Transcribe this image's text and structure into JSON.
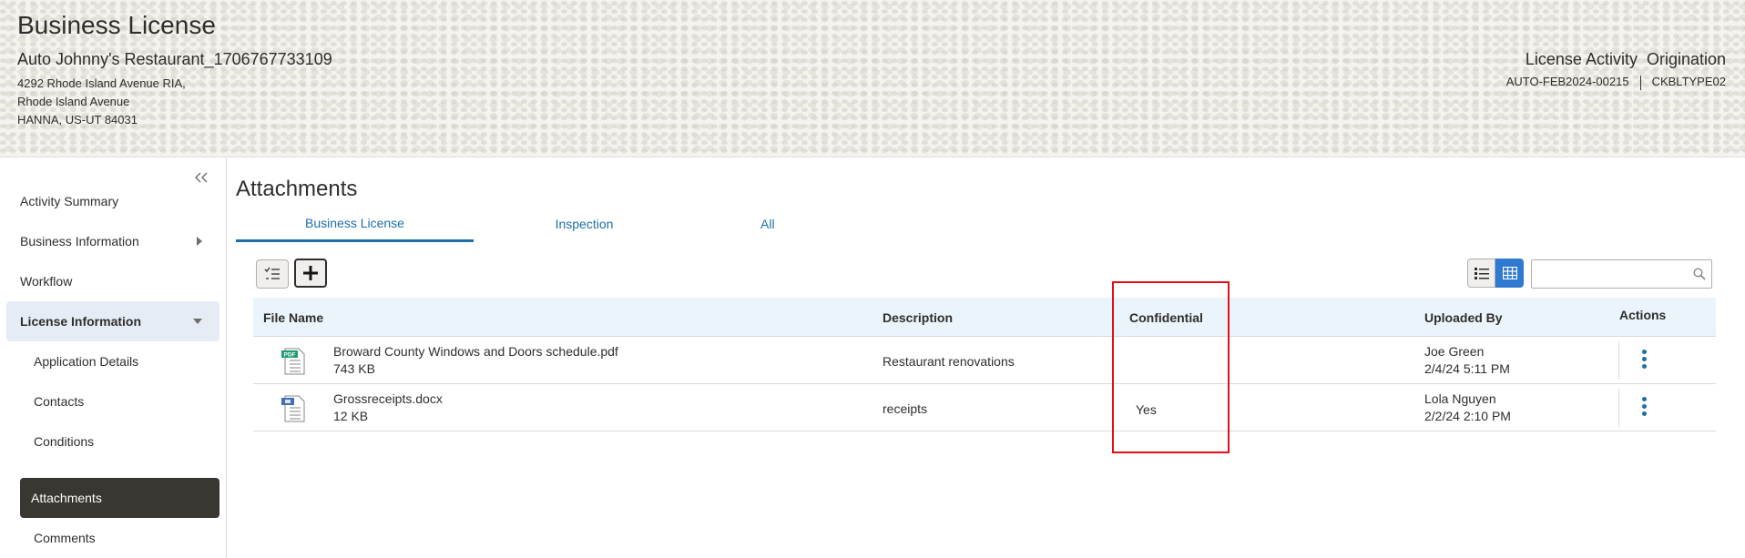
{
  "header": {
    "title": "Business License",
    "business_name": "Auto Johnny's Restaurant_1706767733109",
    "address_lines": [
      "4292 Rhode Island Avenue RIA,",
      "Rhode Island Avenue",
      "HANNA, US-UT 84031"
    ],
    "activity_label": "License Activity",
    "activity_type": "Origination",
    "record_id": "AUTO-FEB2024-00215",
    "license_type": "CKBLTYPE02"
  },
  "sidebar": {
    "collapse_icon": "double-chevron-left-icon",
    "items": [
      {
        "label": "Activity Summary"
      },
      {
        "label": "Business Information"
      },
      {
        "label": "Workflow"
      },
      {
        "label": "License Information"
      },
      {
        "label": "Application Details"
      },
      {
        "label": "Contacts"
      },
      {
        "label": "Conditions"
      },
      {
        "label": "Attachments"
      },
      {
        "label": "Comments"
      }
    ]
  },
  "main": {
    "title": "Attachments",
    "tabs": [
      {
        "label": "Business License"
      },
      {
        "label": "Inspection"
      },
      {
        "label": "All"
      }
    ],
    "table": {
      "columns": [
        "File Name",
        "Description",
        "Confidential",
        "Uploaded By",
        "Actions"
      ],
      "rows": [
        {
          "file_type": "PDF",
          "file_name": "Broward County Windows and Doors schedule.pdf",
          "size": "743 KB",
          "description": "Restaurant renovations",
          "confidential": "",
          "uploaded_by": "Joe Green",
          "uploaded_at": "2/4/24 5:11 PM"
        },
        {
          "file_type": "DOCX",
          "file_name": "Grossreceipts.docx",
          "size": "12 KB",
          "description": "receipts",
          "confidential": "Yes",
          "uploaded_by": "Lola Nguyen",
          "uploaded_at": "2/2/24 2:10 PM"
        }
      ]
    },
    "search_placeholder": ""
  },
  "colors": {
    "accent": "#1d6fa8",
    "selected_nav_bg": "#3a3631",
    "table_header_bg": "#eaf4fb",
    "highlight": "#e0101a"
  }
}
